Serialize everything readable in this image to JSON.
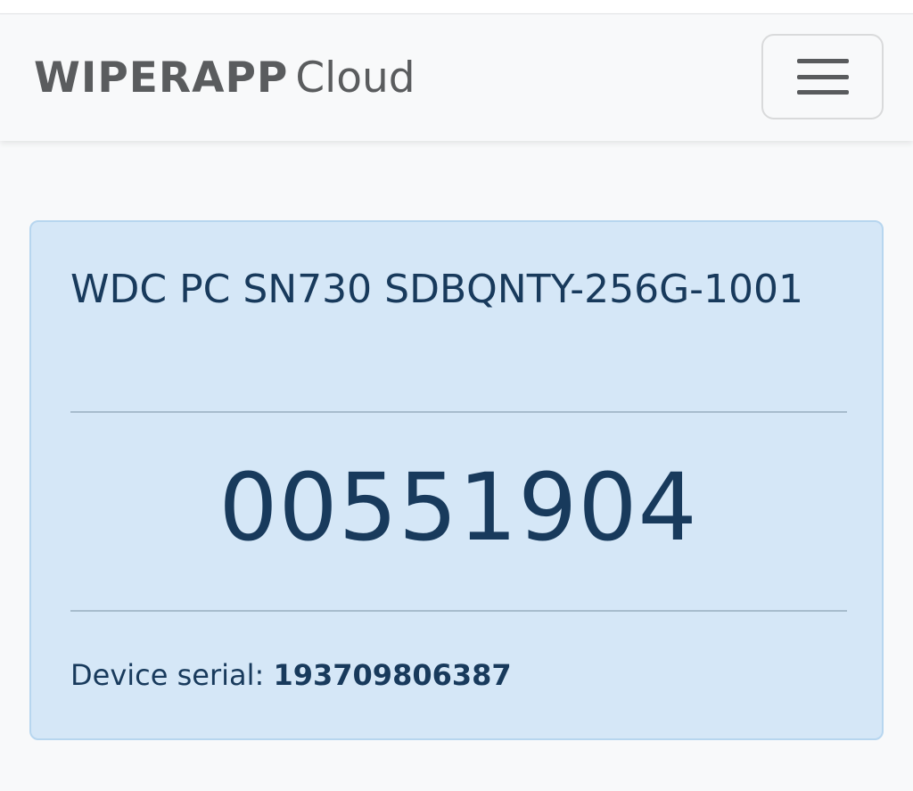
{
  "navbar": {
    "brand_main": "WIPERAPP",
    "brand_sub": "Cloud",
    "menu_icon": "hamburger-menu-icon"
  },
  "card": {
    "device_name": "WDC PC SN730 SDBQNTY-256G-1001",
    "code": "00551904",
    "serial_label": "Device serial:",
    "serial_value": "193709806387"
  },
  "colors": {
    "card_background": "#d5e7f7",
    "card_border": "#b7d6ef",
    "text_primary": "#183a5c",
    "brand_gray": "#5a5c5e"
  }
}
